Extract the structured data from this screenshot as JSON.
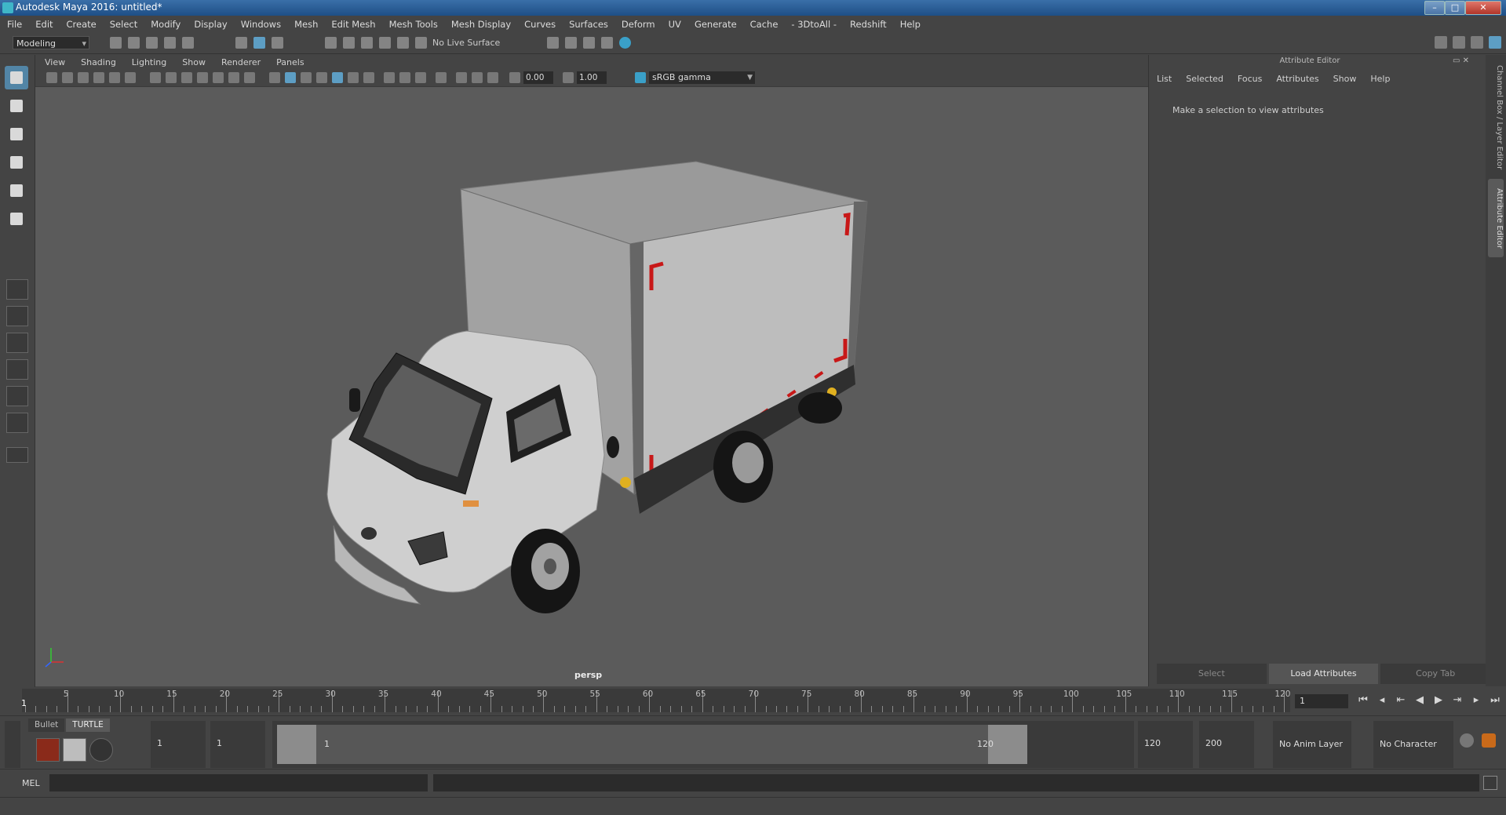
{
  "window": {
    "title": "Autodesk Maya 2016: untitled*"
  },
  "menubar": [
    "File",
    "Edit",
    "Create",
    "Select",
    "Modify",
    "Display",
    "Windows",
    "Mesh",
    "Edit Mesh",
    "Mesh Tools",
    "Mesh Display",
    "Curves",
    "Surfaces",
    "Deform",
    "UV",
    "Generate",
    "Cache",
    "- 3DtoAll -",
    "Redshift",
    "Help"
  ],
  "statusline": {
    "menuset": "Modeling",
    "live_surface": "No Live Surface"
  },
  "viewport": {
    "menus": [
      "View",
      "Shading",
      "Lighting",
      "Show",
      "Renderer",
      "Panels"
    ],
    "exposure": "0.00",
    "gamma": "1.00",
    "color_space": "sRGB gamma",
    "camera": "persp"
  },
  "attribute_editor": {
    "title": "Attribute Editor",
    "tabs": [
      "List",
      "Selected",
      "Focus",
      "Attributes",
      "Show",
      "Help"
    ],
    "message": "Make a selection to view attributes",
    "buttons": {
      "select": "Select",
      "load": "Load Attributes",
      "copy": "Copy Tab"
    }
  },
  "side_tabs": {
    "channel_box": "Channel Box / Layer Editor",
    "attribute_editor": "Attribute Editor"
  },
  "timeslider": {
    "ticks": [
      "5",
      "10",
      "15",
      "20",
      "25",
      "30",
      "35",
      "40",
      "45",
      "50",
      "55",
      "60",
      "65",
      "70",
      "75",
      "80",
      "85",
      "90",
      "95",
      "100",
      "105",
      "110",
      "115",
      "120"
    ],
    "current_frame": "1",
    "frame_field": "1"
  },
  "range": {
    "shelf_tabs": [
      "Bullet",
      "TURTLE"
    ],
    "start_time": "1",
    "playback_start": "1",
    "range_start_label": "1",
    "range_end_label": "120",
    "playback_end": "120",
    "end_time": "200",
    "anim_layer": "No Anim Layer",
    "character_set": "No Character Set"
  },
  "command_line": {
    "language": "MEL"
  }
}
